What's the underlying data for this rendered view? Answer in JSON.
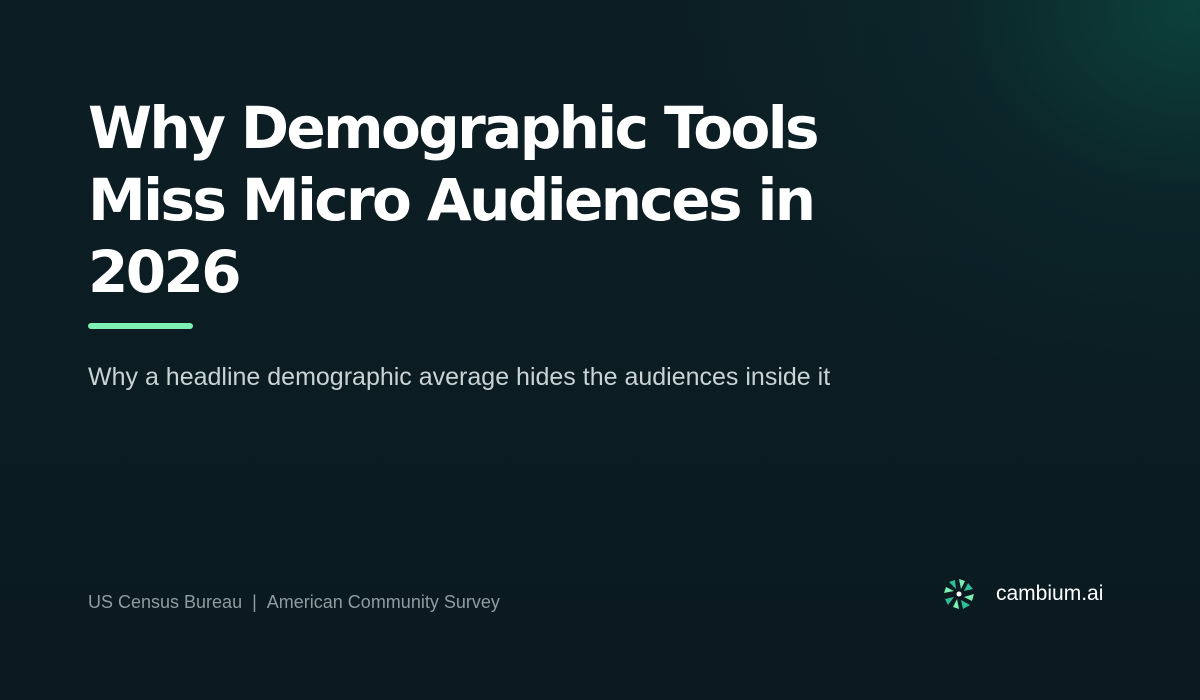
{
  "slide": {
    "title": "Why Demographic Tools Miss Micro Audiences in 2026",
    "subtitle": "Why a headline demographic average hides the audiences inside it"
  },
  "footer": {
    "source_primary": "US Census Bureau",
    "separator": "|",
    "source_secondary": "American Community Survey"
  },
  "brand": {
    "name": "cambium.ai",
    "logo_icon": "cambium-logo-icon"
  },
  "colors": {
    "background": "#0b1c22",
    "glow": "#0c5c4e",
    "accent": "#7ef0b4",
    "title_text": "#ffffff",
    "subtitle_text": "#c9d3d6",
    "footer_text": "#8d9ca1"
  }
}
